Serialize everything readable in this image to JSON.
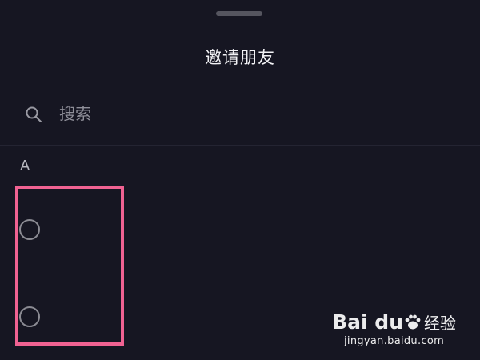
{
  "sheet": {
    "title": "邀请朋友"
  },
  "search": {
    "placeholder": "搜索",
    "icon": "search-icon"
  },
  "contacts": {
    "section_letter": "A",
    "items": [
      {
        "selected": false
      },
      {
        "selected": false
      }
    ]
  },
  "annotation": {
    "highlight_color": "#f06292"
  },
  "watermark": {
    "logo_text": "Bai du",
    "logo_cn": "经验",
    "url": "jingyan.baidu.com"
  },
  "colors": {
    "background": "#161622",
    "title": "#f2f2f5",
    "radio_border": "#8b8b93"
  }
}
